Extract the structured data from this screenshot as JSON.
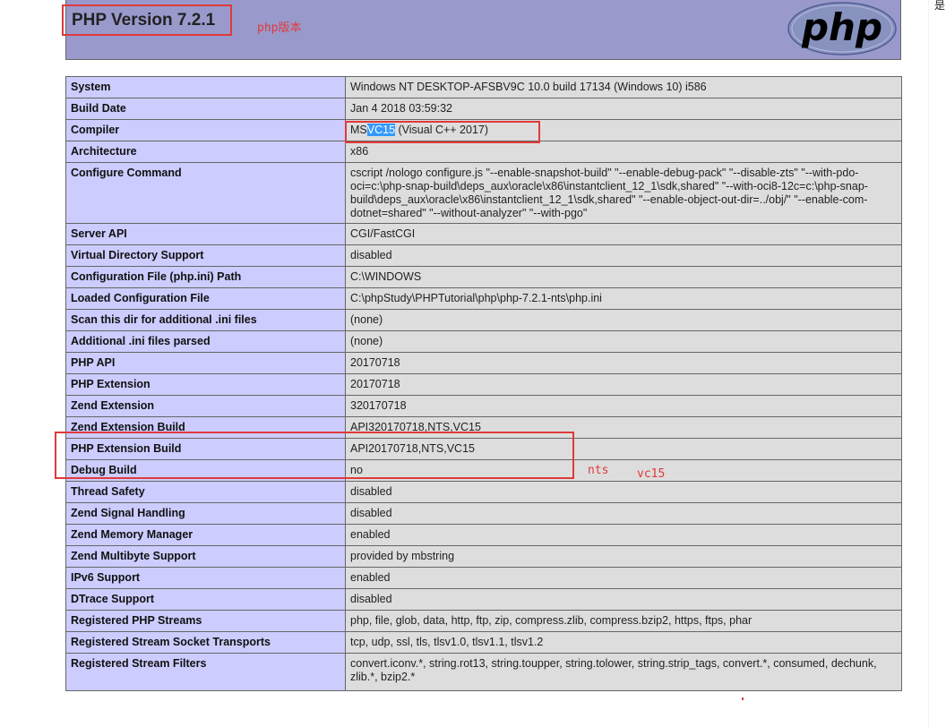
{
  "header": {
    "title": "PHP Version 7.2.1",
    "logo_text": "php"
  },
  "compiler": {
    "prefix": "MS",
    "highlight": "VC15",
    "suffix": " (Visual C++ 2017)"
  },
  "rows": [
    {
      "k": "System",
      "v": "Windows NT DESKTOP-AFSBV9C 10.0 build 17134 (Windows 10) i586"
    },
    {
      "k": "Build Date",
      "v": "Jan 4 2018 03:59:32"
    },
    {
      "k": "Compiler",
      "v": ""
    },
    {
      "k": "Architecture",
      "v": "x86"
    },
    {
      "k": "Configure Command",
      "v": "cscript /nologo configure.js \"--enable-snapshot-build\" \"--enable-debug-pack\" \"--disable-zts\" \"--with-pdo-oci=c:\\php-snap-build\\deps_aux\\oracle\\x86\\instantclient_12_1\\sdk,shared\" \"--with-oci8-12c=c:\\php-snap-build\\deps_aux\\oracle\\x86\\instantclient_12_1\\sdk,shared\" \"--enable-object-out-dir=../obj/\" \"--enable-com-dotnet=shared\" \"--without-analyzer\" \"--with-pgo\""
    },
    {
      "k": "Server API",
      "v": "CGI/FastCGI"
    },
    {
      "k": "Virtual Directory Support",
      "v": "disabled"
    },
    {
      "k": "Configuration File (php.ini) Path",
      "v": "C:\\WINDOWS"
    },
    {
      "k": "Loaded Configuration File",
      "v": "C:\\phpStudy\\PHPTutorial\\php\\php-7.2.1-nts\\php.ini"
    },
    {
      "k": "Scan this dir for additional .ini files",
      "v": "(none)"
    },
    {
      "k": "Additional .ini files parsed",
      "v": "(none)"
    },
    {
      "k": "PHP API",
      "v": "20170718"
    },
    {
      "k": "PHP Extension",
      "v": "20170718"
    },
    {
      "k": "Zend Extension",
      "v": "320170718"
    },
    {
      "k": "Zend Extension Build",
      "v": "API320170718,NTS,VC15"
    },
    {
      "k": "PHP Extension Build",
      "v": "API20170718,NTS,VC15"
    },
    {
      "k": "Debug Build",
      "v": "no"
    },
    {
      "k": "Thread Safety",
      "v": "disabled"
    },
    {
      "k": "Zend Signal Handling",
      "v": "disabled"
    },
    {
      "k": "Zend Memory Manager",
      "v": "enabled"
    },
    {
      "k": "Zend Multibyte Support",
      "v": "provided by mbstring"
    },
    {
      "k": "IPv6 Support",
      "v": "enabled"
    },
    {
      "k": "DTrace Support",
      "v": "disabled"
    },
    {
      "k": "Registered PHP Streams",
      "v": "php, file, glob, data, http, ftp, zip, compress.zlib, compress.bzip2, https, ftps, phar"
    },
    {
      "k": "Registered Stream Socket Transports",
      "v": "tcp, udp, ssl, tls, tlsv1.0, tlsv1.1, tlsv1.2"
    },
    {
      "k": "Registered Stream Filters",
      "v": "convert.iconv.*, string.rot13, string.toupper, string.tolower, string.strip_tags, convert.*, consumed, dechunk, zlib.*, bzip2.*"
    }
  ],
  "annotations": {
    "version": "php版本",
    "nts": "nts",
    "vc": "vc15",
    "corner": "是"
  },
  "colors": {
    "header_bg": "#9999cc",
    "key_bg": "#ccccff",
    "value_bg": "#dddddd",
    "annotation_red": "#e03a3a",
    "selection": "#3399ff"
  }
}
